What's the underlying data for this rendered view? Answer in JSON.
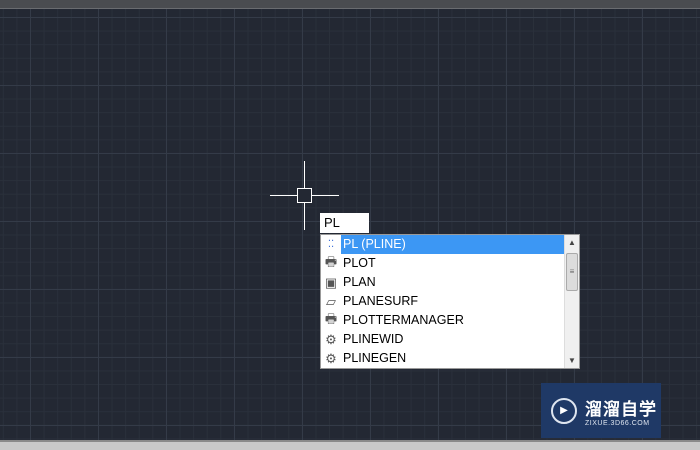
{
  "command_input": {
    "value": "PL"
  },
  "autocomplete": {
    "items": [
      {
        "label": "PL (PLINE)",
        "icon": "polyline-icon",
        "selected": true
      },
      {
        "label": "PLOT",
        "icon": "printer-icon"
      },
      {
        "label": "PLAN",
        "icon": "plan-icon"
      },
      {
        "label": "PLANESURF",
        "icon": "planesurf-icon"
      },
      {
        "label": "PLOTTERMANAGER",
        "icon": "plotter-manager-icon"
      },
      {
        "label": "PLINEWID",
        "icon": "gear-icon"
      },
      {
        "label": "PLINEGEN",
        "icon": "gear-icon"
      }
    ]
  },
  "watermark": {
    "title": "溜溜自学",
    "url": "ZIXUE.3D66.COM"
  },
  "colors": {
    "selection": "#3c97f4",
    "background": "#232833"
  }
}
